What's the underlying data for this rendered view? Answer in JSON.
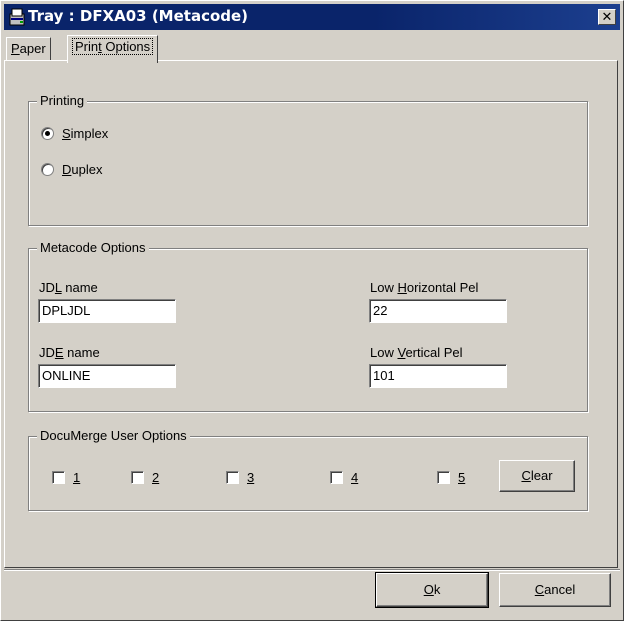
{
  "window": {
    "title": "Tray : DFXA03 (Metacode)",
    "close_glyph": "✕",
    "icon": "tray-icon"
  },
  "tabs": [
    {
      "label_pre": "",
      "label_key": "P",
      "label_post": "aper",
      "active": false
    },
    {
      "label_pre": "Prin",
      "label_key": "t",
      "label_post": " Options",
      "active": true
    }
  ],
  "printing": {
    "title": "Printing",
    "options": [
      {
        "label_key": "S",
        "label_rest": "implex",
        "selected": true
      },
      {
        "label_key": "D",
        "label_rest": "uplex",
        "selected": false
      }
    ]
  },
  "metacode": {
    "title": "Metacode Options",
    "jdl": {
      "label_pre": "JD",
      "label_key": "L",
      "label_post": " name",
      "value": "DPLJDL"
    },
    "jde": {
      "label_pre": "JD",
      "label_key": "E",
      "label_post": " name",
      "value": "ONLINE"
    },
    "low_h": {
      "label_pre": "Low ",
      "label_key": "H",
      "label_post": "orizontal Pel",
      "value": "22"
    },
    "low_v": {
      "label_pre": "Low ",
      "label_key": "V",
      "label_post": "ertical Pel",
      "value": "101"
    }
  },
  "documerge": {
    "title": "DocuMerge User Options",
    "options": [
      {
        "label": "1",
        "checked": false
      },
      {
        "label": "2",
        "checked": false
      },
      {
        "label": "3",
        "checked": false
      },
      {
        "label": "4",
        "checked": false
      },
      {
        "label": "5",
        "checked": false
      }
    ],
    "clear_key": "C",
    "clear_rest": "lear"
  },
  "footer": {
    "ok_key": "O",
    "ok_rest": "k",
    "cancel_key": "C",
    "cancel_rest": "ancel"
  },
  "colors": {
    "face": "#d4d0c8",
    "title_bar": "#0a246a",
    "title_text": "#ffffff"
  }
}
